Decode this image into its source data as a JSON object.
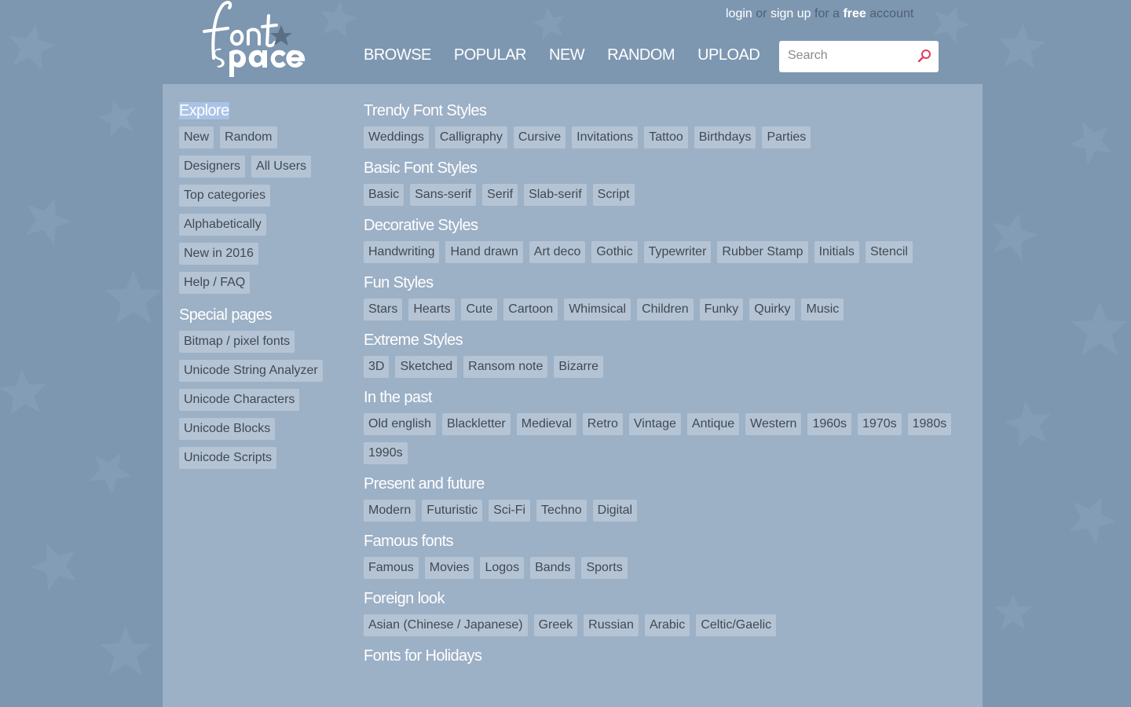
{
  "header": {
    "logo_text": "font space",
    "account": {
      "login": "login",
      "or": "or",
      "signup": "sign up",
      "for_a": "for a",
      "free": "free",
      "account": "account"
    },
    "nav": [
      "BROWSE",
      "POPULAR",
      "NEW",
      "RANDOM",
      "UPLOAD"
    ],
    "search_placeholder": "Search"
  },
  "sidebar": {
    "explore_title": "Explore",
    "explore_links": [
      [
        "New",
        "Random"
      ],
      [
        "Designers",
        "All Users"
      ],
      [
        "Top categories"
      ],
      [
        "Alphabetically"
      ],
      [
        "New in 2016"
      ],
      [
        "Help / FAQ"
      ]
    ],
    "special_title": "Special pages",
    "special_links": [
      "Bitmap / pixel fonts",
      "Unicode String Analyzer",
      "Unicode Characters",
      "Unicode Blocks",
      "Unicode Scripts"
    ]
  },
  "categories": [
    {
      "title": "Trendy Font Styles",
      "tags": [
        "Weddings",
        "Calligraphy",
        "Cursive",
        "Invitations",
        "Tattoo",
        "Birthdays",
        "Parties"
      ]
    },
    {
      "title": "Basic Font Styles",
      "tags": [
        "Basic",
        "Sans-serif",
        "Serif",
        "Slab-serif",
        "Script"
      ]
    },
    {
      "title": "Decorative Styles",
      "tags": [
        "Handwriting",
        "Hand drawn",
        "Art deco",
        "Gothic",
        "Typewriter",
        "Rubber Stamp",
        "Initials",
        "Stencil"
      ]
    },
    {
      "title": "Fun Styles",
      "tags": [
        "Stars",
        "Hearts",
        "Cute",
        "Cartoon",
        "Whimsical",
        "Children",
        "Funky",
        "Quirky",
        "Music"
      ]
    },
    {
      "title": "Extreme Styles",
      "tags": [
        "3D",
        "Sketched",
        "Ransom note",
        "Bizarre"
      ]
    },
    {
      "title": "In the past",
      "tags": [
        "Old english",
        "Blackletter",
        "Medieval",
        "Retro",
        "Vintage",
        "Antique",
        "Western",
        "1960s",
        "1970s",
        "1980s",
        "1990s"
      ]
    },
    {
      "title": "Present and future",
      "tags": [
        "Modern",
        "Futuristic",
        "Sci-Fi",
        "Techno",
        "Digital"
      ]
    },
    {
      "title": "Famous fonts",
      "tags": [
        "Famous",
        "Movies",
        "Logos",
        "Bands",
        "Sports"
      ]
    },
    {
      "title": "Foreign look",
      "tags": [
        "Asian (Chinese / Japanese)",
        "Greek",
        "Russian",
        "Arabic",
        "Celtic/Gaelic"
      ]
    },
    {
      "title": "Fonts for Holidays",
      "tags": []
    }
  ],
  "colors": {
    "background": "#7d97b1",
    "panel": "#a3b7cb",
    "search_icon": "#e0405a"
  }
}
